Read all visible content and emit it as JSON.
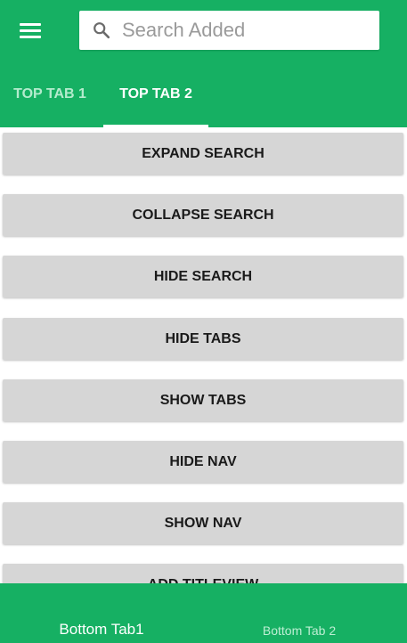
{
  "colors": {
    "primary": "#16b063",
    "button_bg": "#d6d6d6",
    "inactive_tab_text": "#b4ebcd"
  },
  "appbar": {
    "menu_icon": "hamburger-menu-icon",
    "search": {
      "icon": "search-icon",
      "placeholder": "Search Added"
    },
    "tabs": [
      {
        "label": "TOP TAB 1",
        "selected": false
      },
      {
        "label": "TOP TAB 2",
        "selected": true
      }
    ]
  },
  "buttons": [
    {
      "label": "EXPAND SEARCH"
    },
    {
      "label": "COLLAPSE SEARCH"
    },
    {
      "label": "HIDE SEARCH"
    },
    {
      "label": "HIDE TABS"
    },
    {
      "label": "SHOW TABS"
    },
    {
      "label": "HIDE NAV"
    },
    {
      "label": "SHOW NAV"
    },
    {
      "label": "ADD TITLEVIEW"
    }
  ],
  "bottom_nav": {
    "tabs": [
      {
        "label": "Bottom Tab1",
        "selected": true
      },
      {
        "label": "Bottom Tab 2",
        "selected": false
      }
    ]
  }
}
